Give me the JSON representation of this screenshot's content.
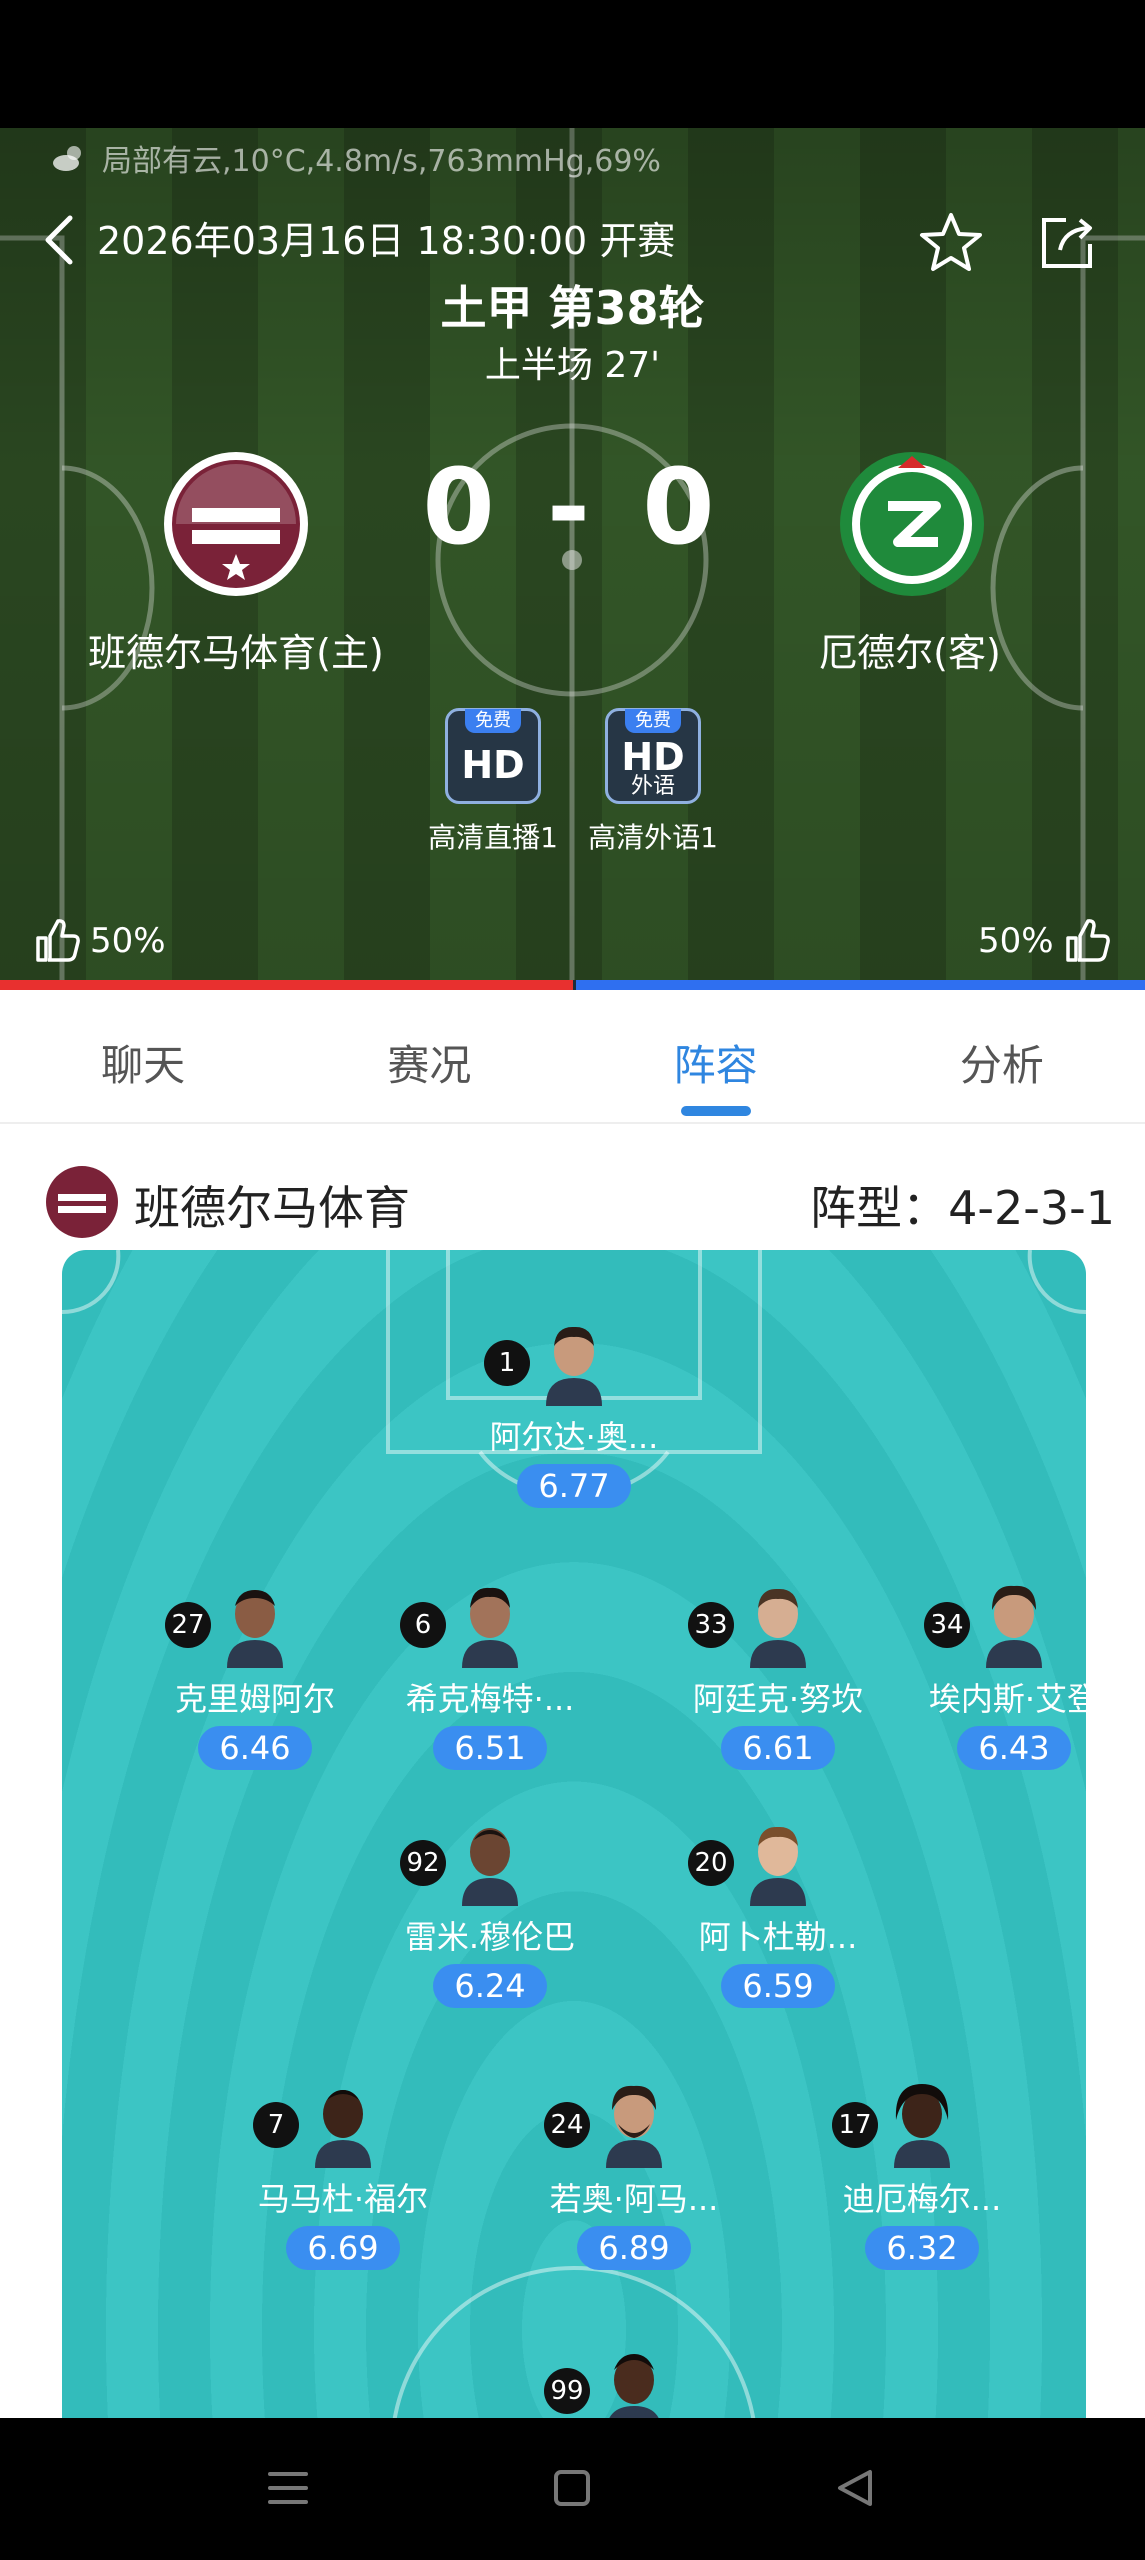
{
  "header": {
    "weather": "局部有云,10°C,4.8m/s,763mmHg,69%",
    "kickoff": "2026年03月16日 18:30:00 开赛",
    "league_round": "土甲 第38轮",
    "period": "上半场 27'",
    "score": "0 - 0",
    "home_team": "班德尔马体育(主)",
    "away_team": "厄德尔(客)",
    "home_support": "50%",
    "away_support": "50%",
    "home_support_fraction": 0.5,
    "colors": {
      "home": "#e8302f",
      "away": "#2f6ff0"
    }
  },
  "streams": [
    {
      "badge": "免费",
      "icon": "HD",
      "sub": "",
      "label": "高清直播1"
    },
    {
      "badge": "免费",
      "icon": "HD",
      "sub": "外语",
      "label": "高清外语1"
    }
  ],
  "tabs": [
    {
      "label": "聊天"
    },
    {
      "label": "赛况"
    },
    {
      "label": "阵容"
    },
    {
      "label": "分析"
    }
  ],
  "lineup": {
    "team": "班德尔马体育",
    "formation": "阵型：4-2-3-1",
    "players": [
      {
        "number": "1",
        "name": "阿尔达·奥...",
        "rating": "6.77"
      },
      {
        "number": "27",
        "name": "克里姆阿尔",
        "rating": "6.46"
      },
      {
        "number": "6",
        "name": "希克梅特·...",
        "rating": "6.51"
      },
      {
        "number": "33",
        "name": "阿廷克·努坎",
        "rating": "6.61"
      },
      {
        "number": "34",
        "name": "埃内斯·艾登",
        "rating": "6.43"
      },
      {
        "number": "92",
        "name": "雷米.穆伦巴",
        "rating": "6.24"
      },
      {
        "number": "20",
        "name": "阿卜杜勒...",
        "rating": "6.59"
      },
      {
        "number": "7",
        "name": "马马杜·福尔",
        "rating": "6.69"
      },
      {
        "number": "24",
        "name": "若奥·阿马...",
        "rating": "6.89"
      },
      {
        "number": "17",
        "name": "迪厄梅尔...",
        "rating": "6.32"
      },
      {
        "number": "99",
        "name": "",
        "rating": ""
      }
    ]
  },
  "icons": {
    "weather": "cloud-sun-icon",
    "back": "chevron-left-icon",
    "favorite": "star-icon",
    "share": "share-icon",
    "like": "thumbs-up-icon",
    "nav": [
      "menu-icon",
      "home-square-icon",
      "back-triangle-icon"
    ]
  }
}
